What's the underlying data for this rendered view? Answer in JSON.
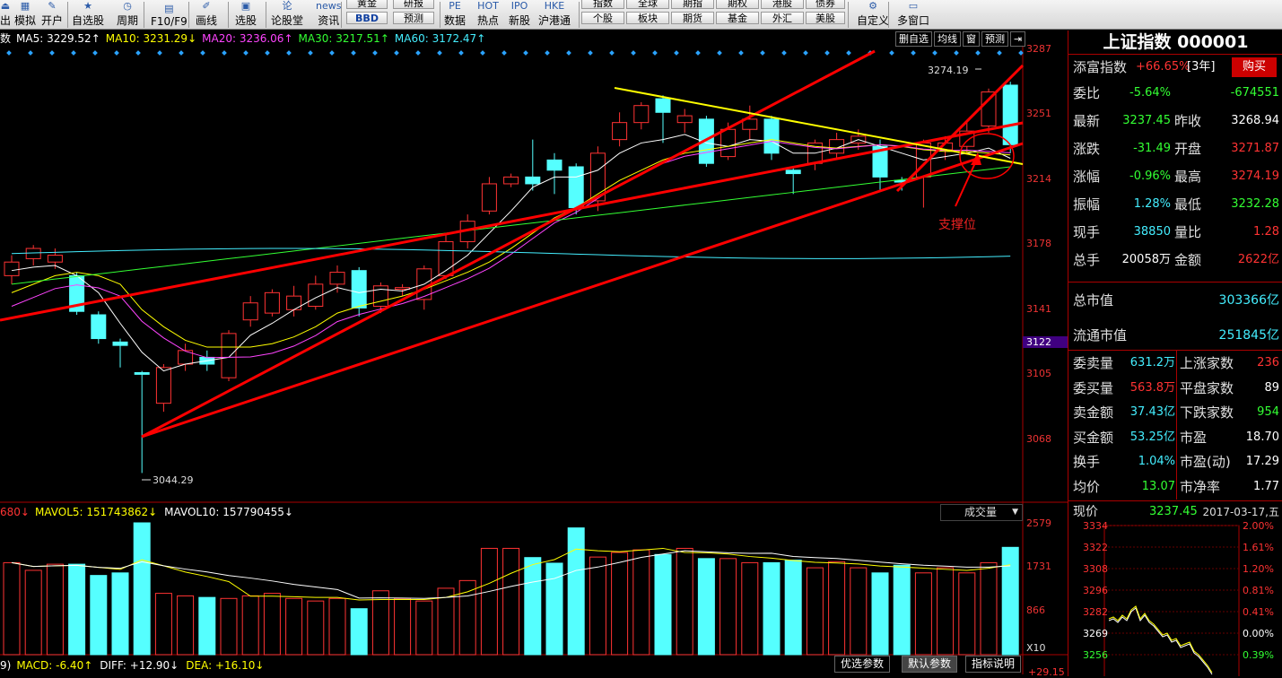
{
  "toolbar": {
    "items": [
      {
        "label": "出",
        "icon": "exit-icon"
      },
      {
        "label": "模拟",
        "icon": "simulate-icon"
      },
      {
        "label": "开户",
        "icon": "account-icon"
      },
      {
        "label": "自选股",
        "icon": "star-icon"
      },
      {
        "label": "周期",
        "icon": "clock-icon"
      },
      {
        "label": "F10/F9",
        "icon": "document-icon"
      },
      {
        "label": "画线",
        "icon": "pen-icon"
      },
      {
        "label": "选股",
        "icon": "screen-icon"
      },
      {
        "label": "论股堂",
        "icon": "forum-icon"
      },
      {
        "label": "资讯",
        "icon": "news-icon"
      },
      {
        "label": "数据",
        "icon": "pe-icon"
      },
      {
        "label": "热点",
        "icon": "hot-icon"
      },
      {
        "label": "新股",
        "icon": "ipo-icon"
      },
      {
        "label": "沪港通",
        "icon": "hke-icon"
      },
      {
        "label": "自定义",
        "icon": "custom-icon"
      },
      {
        "label": "多窗口",
        "icon": "window-icon"
      }
    ],
    "icon_texts": {
      "news": "news",
      "pe": "PE",
      "hot": "HOT",
      "ipo": "IPO",
      "hke": "HKE"
    },
    "top_buttons": [
      "黄金",
      "研报",
      "指数",
      "全球",
      "期指",
      "期权",
      "港股",
      "债券"
    ],
    "sub_buttons": [
      "BBD",
      "预测",
      "个股",
      "板块",
      "期货",
      "基金",
      "外汇",
      "美股"
    ]
  },
  "ma_bar": {
    "prefix": "数",
    "ma5": "MA5: 3229.52↑",
    "ma10": "MA10: 3231.29↓",
    "ma20": "MA20: 3236.06↑",
    "ma30": "MA30: 3217.51↑",
    "ma60": "MA60: 3172.47↑",
    "buttons": [
      "删自选",
      "均线",
      "窗",
      "预测",
      "⇥"
    ]
  },
  "price_axis": [
    "3287",
    "3251",
    "3214",
    "3178",
    "3141",
    "3122",
    "3105",
    "3068"
  ],
  "annotations": {
    "high": "3274.19",
    "low": "3044.29",
    "support": "支撑位"
  },
  "volume_bar": {
    "prefix": "680↓",
    "mavol5": "MAVOL5: 151743862↓",
    "mavol10": "MAVOL10: 157790455↓",
    "dropdown": "成交量"
  },
  "volume_axis": [
    "2579",
    "1731",
    "866",
    "X10"
  ],
  "macd_bar": {
    "prefix": "9)",
    "macd": "MACD: -6.40↑",
    "diff": "DIFF: +12.90↓",
    "dea": "DEA: +16.10↓",
    "tabs": [
      "优选参数",
      "默认参数",
      "指标说明"
    ],
    "axis_value": "+29.15"
  },
  "right_panel": {
    "title": "上证指数 000001",
    "tianfu_label": "添富指数",
    "tianfu_value": "+66.65%",
    "tianfu_period": "[3年]",
    "buy_label": "购买",
    "rows": [
      {
        "l1": "委比",
        "v1": "-5.64%",
        "v2": "-674551"
      },
      {
        "l1": "最新",
        "v1": "3237.45",
        "l2": "昨收",
        "v2": "3268.94"
      },
      {
        "l1": "涨跌",
        "v1": "-31.49",
        "l2": "开盘",
        "v2": "3271.87"
      },
      {
        "l1": "涨幅",
        "v1": "-0.96%",
        "l2": "最高",
        "v2": "3274.19"
      },
      {
        "l1": "振幅",
        "v1": "1.28%",
        "l2": "最低",
        "v2": "3232.28"
      },
      {
        "l1": "现手",
        "v1": "38850",
        "l2": "量比",
        "v2": "1.28"
      },
      {
        "l1": "总手",
        "v1": "20058万",
        "l2": "金额",
        "v2": "2622亿"
      }
    ],
    "total_cap_label": "总市值",
    "total_cap": "303366亿",
    "float_cap_label": "流通市值",
    "float_cap": "251845亿",
    "rows2": [
      {
        "l1": "委卖量",
        "v1": "631.2万",
        "l2": "上涨家数",
        "v2": "236"
      },
      {
        "l1": "委买量",
        "v1": "563.8万",
        "l2": "平盘家数",
        "v2": "89"
      },
      {
        "l1": "卖金额",
        "v1": "37.43亿",
        "l2": "下跌家数",
        "v2": "954"
      },
      {
        "l1": "买金额",
        "v1": "53.25亿",
        "l2": "市盈",
        "v2": "18.70"
      },
      {
        "l1": "换手",
        "v1": "1.04%",
        "l2": "市盈(动)",
        "v2": "17.29"
      },
      {
        "l1": "均价",
        "v1": "13.07",
        "l2": "市净率",
        "v2": "1.77"
      }
    ],
    "now_label": "现价",
    "now_value": "3237.45",
    "date": "2017-03-17,五",
    "mini_left": [
      "3334",
      "3322",
      "3308",
      "3296",
      "3282",
      "3269",
      "3256"
    ],
    "mini_right": [
      "2.00%",
      "1.61%",
      "1.20%",
      "0.81%",
      "0.41%",
      "0.00%",
      "0.39%"
    ]
  },
  "chart_data": {
    "type": "candlestick",
    "price_range": [
      3040,
      3292
    ],
    "candles": [
      {
        "o": 3160,
        "c": 3168,
        "h": 3172,
        "l": 3155
      },
      {
        "o": 3170,
        "c": 3176,
        "h": 3178,
        "l": 3166
      },
      {
        "o": 3168,
        "c": 3172,
        "h": 3176,
        "l": 3164
      },
      {
        "o": 3160,
        "c": 3139,
        "h": 3162,
        "l": 3137
      },
      {
        "o": 3137,
        "c": 3123,
        "h": 3139,
        "l": 3120
      },
      {
        "o": 3121,
        "c": 3119,
        "h": 3123,
        "l": 3106
      },
      {
        "o": 3103,
        "c": 3102,
        "h": 3104,
        "l": 3044
      },
      {
        "o": 3085,
        "c": 3106,
        "h": 3108,
        "l": 3080
      },
      {
        "o": 3108,
        "c": 3116,
        "h": 3120,
        "l": 3104
      },
      {
        "o": 3112,
        "c": 3108,
        "h": 3116,
        "l": 3104
      },
      {
        "o": 3100,
        "c": 3126,
        "h": 3128,
        "l": 3098
      },
      {
        "o": 3134,
        "c": 3144,
        "h": 3148,
        "l": 3130
      },
      {
        "o": 3138,
        "c": 3150,
        "h": 3152,
        "l": 3136
      },
      {
        "o": 3140,
        "c": 3148,
        "h": 3154,
        "l": 3136
      },
      {
        "o": 3142,
        "c": 3155,
        "h": 3160,
        "l": 3140
      },
      {
        "o": 3155,
        "c": 3162,
        "h": 3166,
        "l": 3150
      },
      {
        "o": 3163,
        "c": 3141,
        "h": 3165,
        "l": 3136
      },
      {
        "o": 3142,
        "c": 3154,
        "h": 3156,
        "l": 3138
      },
      {
        "o": 3152,
        "c": 3153,
        "h": 3155,
        "l": 3148
      },
      {
        "o": 3146,
        "c": 3164,
        "h": 3166,
        "l": 3140
      },
      {
        "o": 3160,
        "c": 3180,
        "h": 3184,
        "l": 3158
      },
      {
        "o": 3180,
        "c": 3192,
        "h": 3196,
        "l": 3176
      },
      {
        "o": 3198,
        "c": 3214,
        "h": 3218,
        "l": 3196
      },
      {
        "o": 3214,
        "c": 3218,
        "h": 3220,
        "l": 3212
      },
      {
        "o": 3218,
        "c": 3214,
        "h": 3240,
        "l": 3210
      },
      {
        "o": 3228,
        "c": 3222,
        "h": 3232,
        "l": 3208
      },
      {
        "o": 3224,
        "c": 3200,
        "h": 3226,
        "l": 3196
      },
      {
        "o": 3204,
        "c": 3232,
        "h": 3236,
        "l": 3198
      },
      {
        "o": 3240,
        "c": 3250,
        "h": 3256,
        "l": 3236
      },
      {
        "o": 3250,
        "c": 3260,
        "h": 3262,
        "l": 3246
      },
      {
        "o": 3264,
        "c": 3256,
        "h": 3266,
        "l": 3238
      },
      {
        "o": 3250,
        "c": 3254,
        "h": 3258,
        "l": 3244
      },
      {
        "o": 3252,
        "c": 3226,
        "h": 3254,
        "l": 3224
      },
      {
        "o": 3230,
        "c": 3246,
        "h": 3250,
        "l": 3228
      },
      {
        "o": 3246,
        "c": 3252,
        "h": 3260,
        "l": 3240
      },
      {
        "o": 3252,
        "c": 3232,
        "h": 3254,
        "l": 3228
      },
      {
        "o": 3222,
        "c": 3220,
        "h": 3224,
        "l": 3208
      },
      {
        "o": 3226,
        "c": 3238,
        "h": 3240,
        "l": 3222
      },
      {
        "o": 3232,
        "c": 3240,
        "h": 3244,
        "l": 3228
      },
      {
        "o": 3238,
        "c": 3242,
        "h": 3246,
        "l": 3234
      },
      {
        "o": 3236,
        "c": 3218,
        "h": 3240,
        "l": 3210
      },
      {
        "o": 3216,
        "c": 3215,
        "h": 3218,
        "l": 3210
      },
      {
        "o": 3218,
        "c": 3238,
        "h": 3240,
        "l": 3200
      },
      {
        "o": 3234,
        "c": 3238,
        "h": 3242,
        "l": 3228
      },
      {
        "o": 3236,
        "c": 3245,
        "h": 3250,
        "l": 3232
      },
      {
        "o": 3248,
        "c": 3268,
        "h": 3270,
        "l": 3244
      },
      {
        "o": 3272,
        "c": 3237,
        "h": 3274,
        "l": 3232
      }
    ],
    "volume_range": [
      0,
      2579
    ],
    "volumes": [
      1800,
      1650,
      1770,
      1770,
      1550,
      1600,
      2579,
      1200,
      1150,
      1120,
      1100,
      1150,
      1200,
      1100,
      1050,
      1100,
      900,
      1250,
      1100,
      1050,
      1300,
      1450,
      2080,
      2080,
      1900,
      1790,
      2480,
      1910,
      2000,
      2050,
      1960,
      2080,
      1880,
      1880,
      1800,
      1800,
      1850,
      1700,
      1820,
      1700,
      1600,
      1750,
      1600,
      1700,
      1600,
      1800,
      2100
    ],
    "ma5": [
      3163,
      3165,
      3166,
      3160,
      3150,
      3132,
      3115,
      3104,
      3108,
      3110,
      3112,
      3125,
      3132,
      3140,
      3147,
      3153,
      3150,
      3152,
      3151,
      3155,
      3163,
      3172,
      3185,
      3198,
      3212,
      3218,
      3218,
      3222,
      3232,
      3238,
      3240,
      3243,
      3238,
      3236,
      3240,
      3239,
      3232,
      3232,
      3235,
      3240,
      3236,
      3232,
      3228,
      3230,
      3232,
      3235,
      3229
    ],
    "ma10": [
      3150,
      3155,
      3160,
      3162,
      3160,
      3155,
      3140,
      3130,
      3122,
      3118,
      3118,
      3118,
      3120,
      3124,
      3130,
      3138,
      3142,
      3145,
      3148,
      3152,
      3157,
      3162,
      3168,
      3176,
      3185,
      3194,
      3200,
      3208,
      3216,
      3222,
      3228,
      3232,
      3234,
      3236,
      3238,
      3240,
      3238,
      3236,
      3235,
      3236,
      3237,
      3236,
      3234,
      3233,
      3233,
      3232,
      3231
    ]
  }
}
